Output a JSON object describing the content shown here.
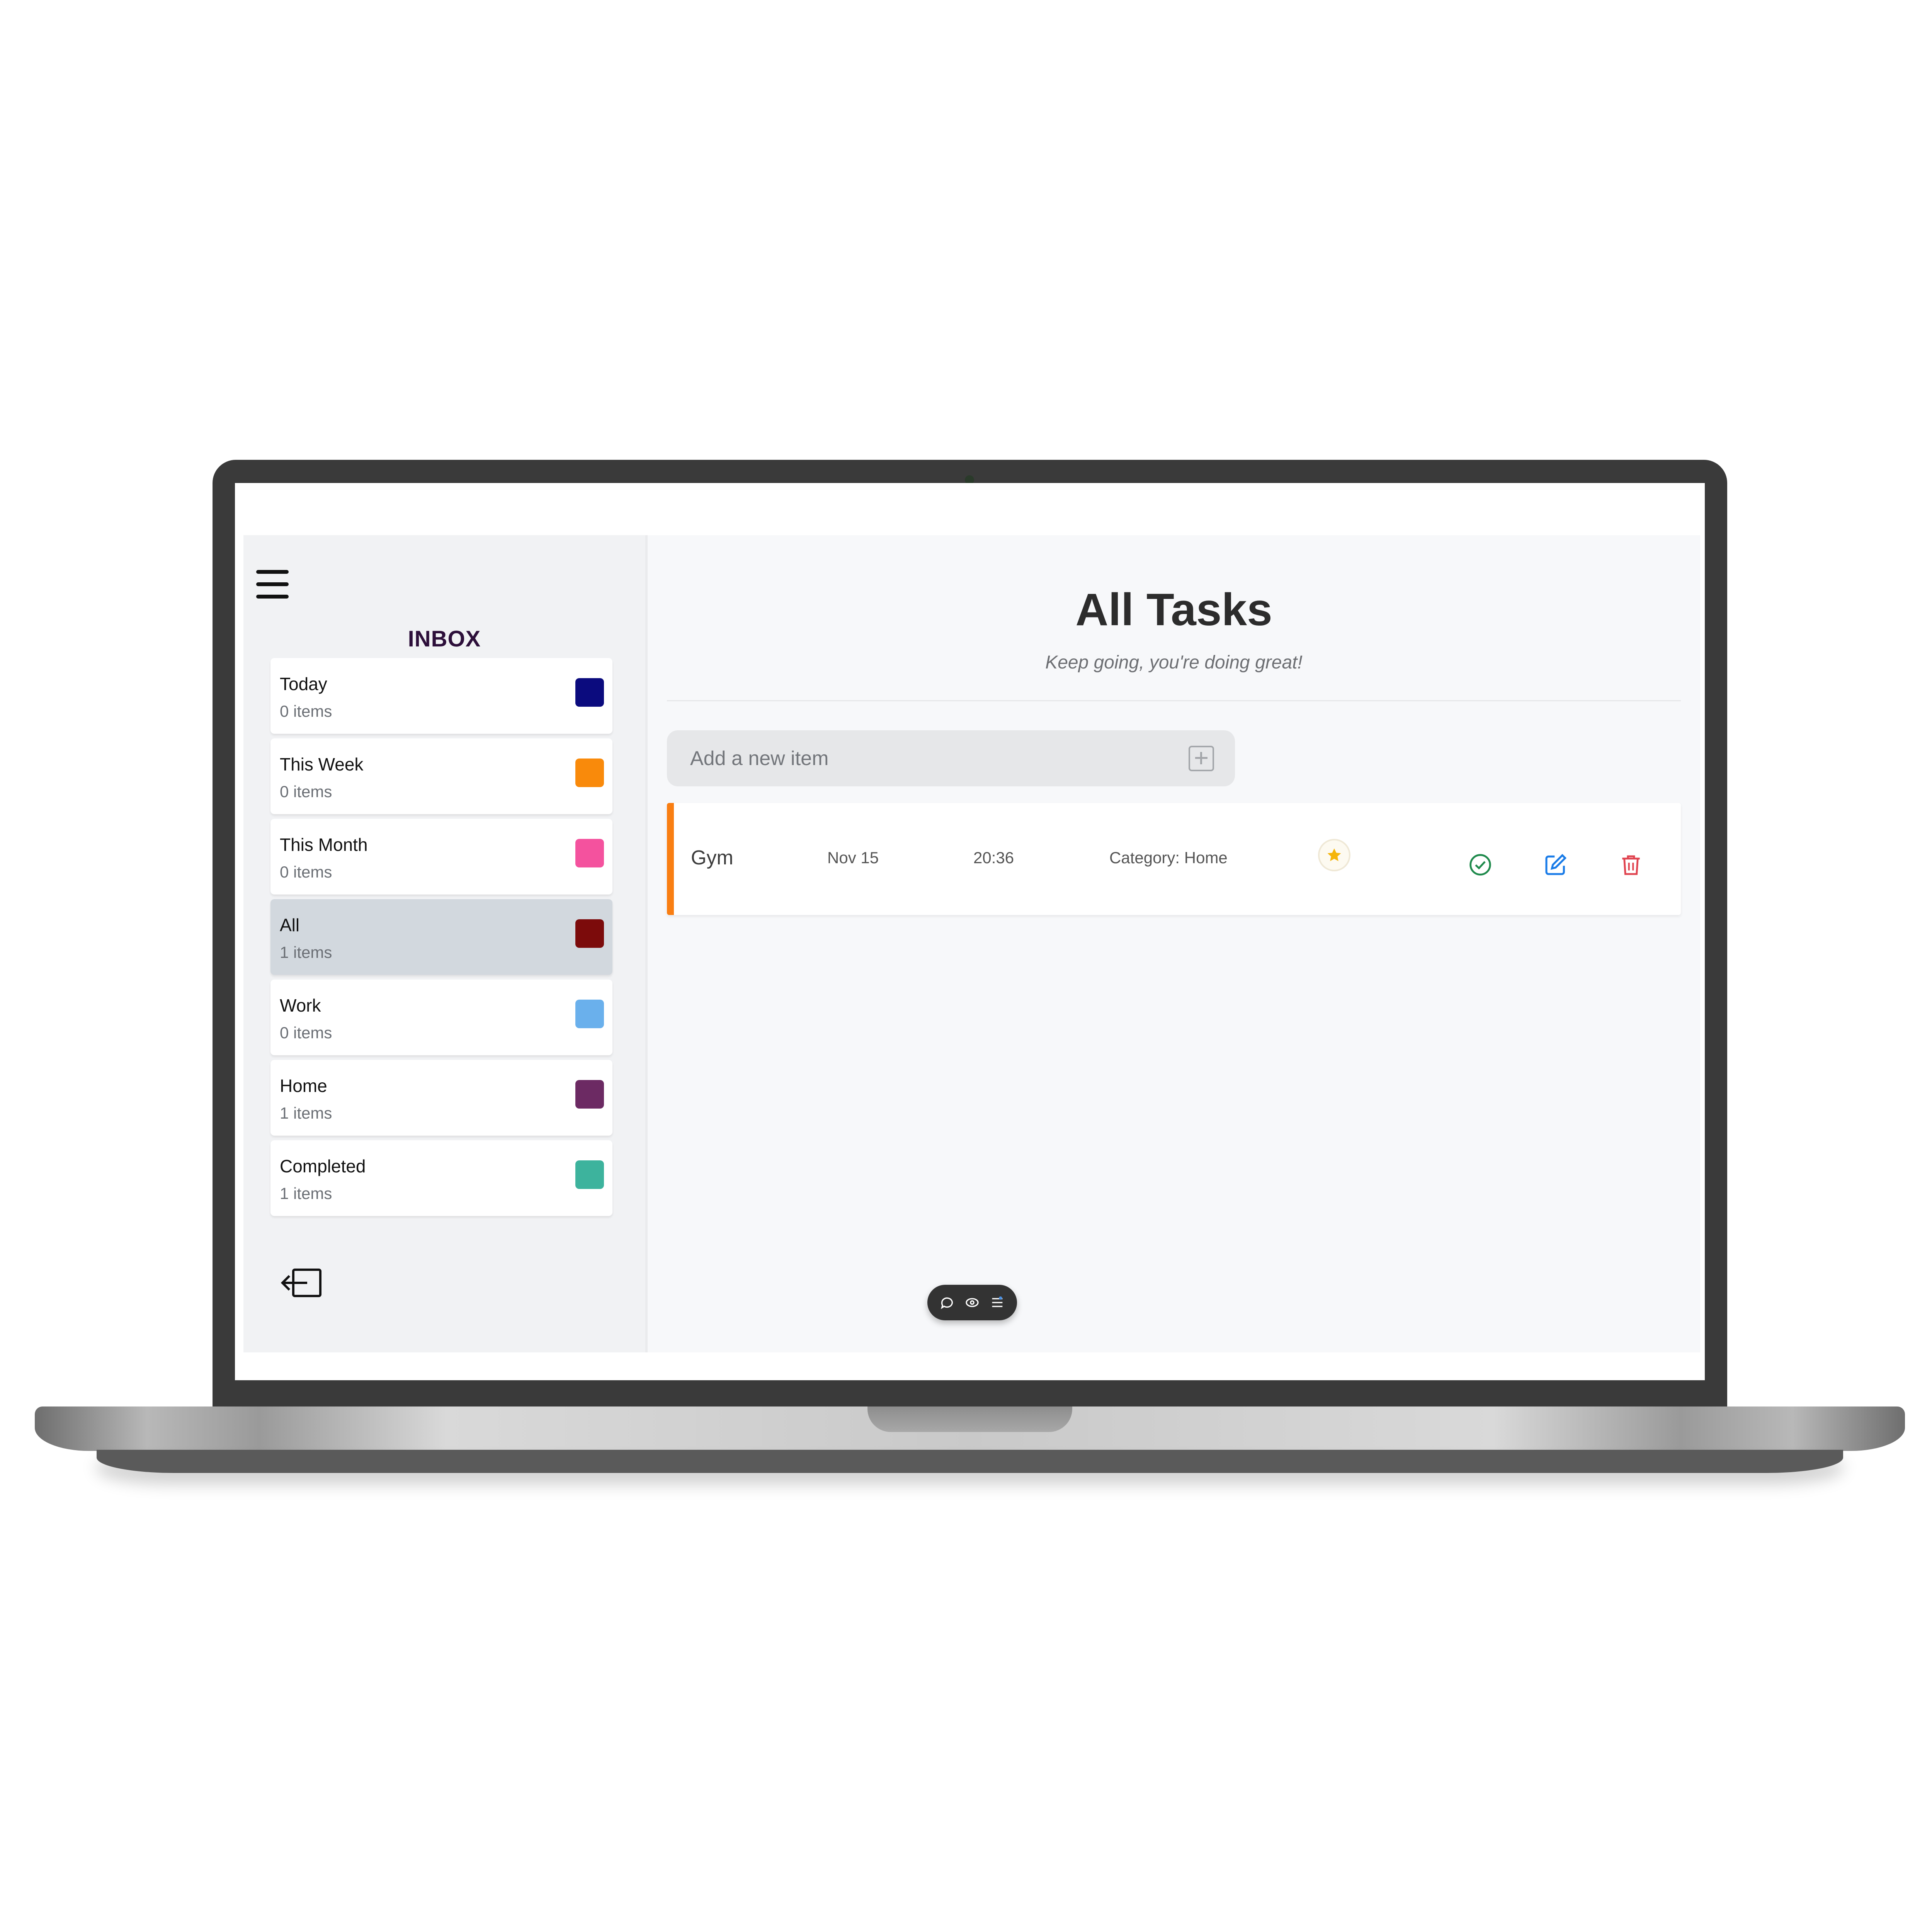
{
  "sidebar": {
    "title": "INBOX",
    "items": [
      {
        "label": "Today",
        "count": "0 items",
        "color": "#0b0b7e"
      },
      {
        "label": "This Week",
        "count": "0 items",
        "color": "#f98a0b"
      },
      {
        "label": "This Month",
        "count": "0 items",
        "color": "#f4529e"
      },
      {
        "label": "All",
        "count": "1 items",
        "color": "#7c0b0b",
        "active": true
      },
      {
        "label": "Work",
        "count": "0 items",
        "color": "#6ab0ec"
      },
      {
        "label": "Home",
        "count": "1 items",
        "color": "#6c2a63"
      },
      {
        "label": "Completed",
        "count": "1 items",
        "color": "#3db39d"
      }
    ]
  },
  "main": {
    "title": "All Tasks",
    "subtitle": "Keep going, you're doing great!",
    "add_placeholder": "Add a new item",
    "tasks": [
      {
        "title": "Gym",
        "date": "Nov 15",
        "time": "20:36",
        "category": "Category: Home",
        "starred": true,
        "accent_color": "#f97e12"
      }
    ]
  },
  "icons": {
    "menu": "hamburger-menu-icon",
    "logout": "logout-icon",
    "add": "plus-square-icon",
    "star": "star-icon",
    "complete": "check-circle-icon",
    "edit": "edit-icon",
    "delete": "trash-icon"
  },
  "colors": {
    "star": "#f5b50a",
    "complete": "#1f8a4c",
    "edit": "#1a7ce8",
    "delete": "#e0434f"
  }
}
